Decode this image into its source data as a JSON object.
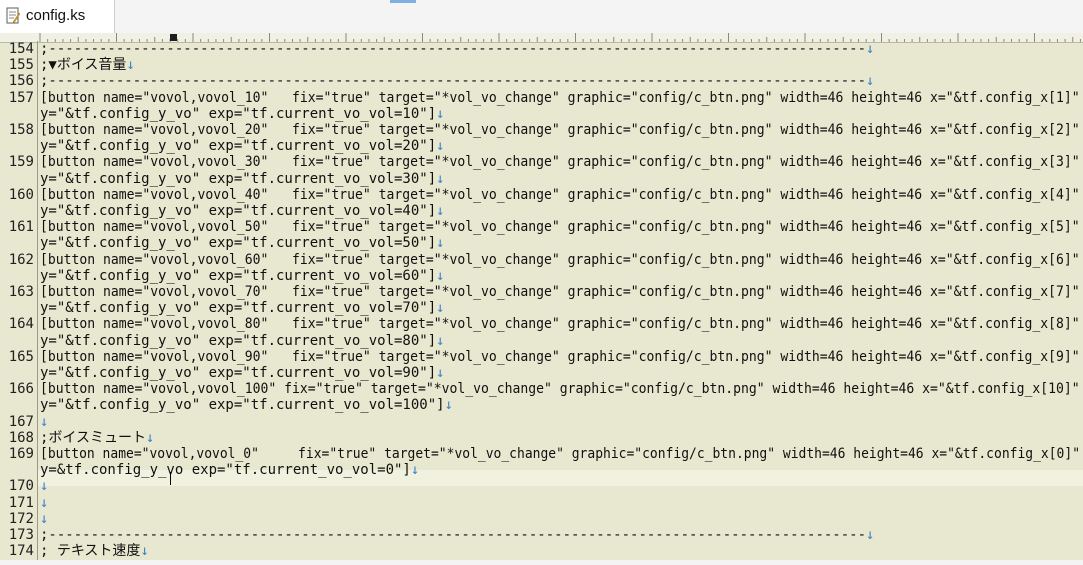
{
  "tab": {
    "title": "config.ks",
    "icon": "document-icon"
  },
  "eol_mark": "↓",
  "lines": [
    {
      "num": "154",
      "text": ";-------------------------------------------------------------------------------------------------"
    },
    {
      "num": "155",
      "text": ";▼ボイス音量"
    },
    {
      "num": "156",
      "text": ";-------------------------------------------------------------------------------------------------"
    },
    {
      "num": "157",
      "text": "[button name=\"vovol,vovol_10\"   fix=\"true\" target=\"*vol_vo_change\" graphic=\"config/c_btn.png\" width=46 height=46 x=\"&tf.config_x[1]\""
    },
    {
      "num": "",
      "text": "y=\"&tf.config_y_vo\" exp=\"tf.current_vo_vol=10\"]"
    },
    {
      "num": "158",
      "text": "[button name=\"vovol,vovol_20\"   fix=\"true\" target=\"*vol_vo_change\" graphic=\"config/c_btn.png\" width=46 height=46 x=\"&tf.config_x[2]\""
    },
    {
      "num": "",
      "text": "y=\"&tf.config_y_vo\" exp=\"tf.current_vo_vol=20\"]"
    },
    {
      "num": "159",
      "text": "[button name=\"vovol,vovol_30\"   fix=\"true\" target=\"*vol_vo_change\" graphic=\"config/c_btn.png\" width=46 height=46 x=\"&tf.config_x[3]\""
    },
    {
      "num": "",
      "text": "y=\"&tf.config_y_vo\" exp=\"tf.current_vo_vol=30\"]"
    },
    {
      "num": "160",
      "text": "[button name=\"vovol,vovol_40\"   fix=\"true\" target=\"*vol_vo_change\" graphic=\"config/c_btn.png\" width=46 height=46 x=\"&tf.config_x[4]\""
    },
    {
      "num": "",
      "text": "y=\"&tf.config_y_vo\" exp=\"tf.current_vo_vol=40\"]"
    },
    {
      "num": "161",
      "text": "[button name=\"vovol,vovol_50\"   fix=\"true\" target=\"*vol_vo_change\" graphic=\"config/c_btn.png\" width=46 height=46 x=\"&tf.config_x[5]\""
    },
    {
      "num": "",
      "text": "y=\"&tf.config_y_vo\" exp=\"tf.current_vo_vol=50\"]"
    },
    {
      "num": "162",
      "text": "[button name=\"vovol,vovol_60\"   fix=\"true\" target=\"*vol_vo_change\" graphic=\"config/c_btn.png\" width=46 height=46 x=\"&tf.config_x[6]\""
    },
    {
      "num": "",
      "text": "y=\"&tf.config_y_vo\" exp=\"tf.current_vo_vol=60\"]"
    },
    {
      "num": "163",
      "text": "[button name=\"vovol,vovol_70\"   fix=\"true\" target=\"*vol_vo_change\" graphic=\"config/c_btn.png\" width=46 height=46 x=\"&tf.config_x[7]\""
    },
    {
      "num": "",
      "text": "y=\"&tf.config_y_vo\" exp=\"tf.current_vo_vol=70\"]"
    },
    {
      "num": "164",
      "text": "[button name=\"vovol,vovol_80\"   fix=\"true\" target=\"*vol_vo_change\" graphic=\"config/c_btn.png\" width=46 height=46 x=\"&tf.config_x[8]\""
    },
    {
      "num": "",
      "text": "y=\"&tf.config_y_vo\" exp=\"tf.current_vo_vol=80\"]"
    },
    {
      "num": "165",
      "text": "[button name=\"vovol,vovol_90\"   fix=\"true\" target=\"*vol_vo_change\" graphic=\"config/c_btn.png\" width=46 height=46 x=\"&tf.config_x[9]\""
    },
    {
      "num": "",
      "text": "y=\"&tf.config_y_vo\" exp=\"tf.current_vo_vol=90\"]"
    },
    {
      "num": "166",
      "text": "[button name=\"vovol,vovol_100\" fix=\"true\" target=\"*vol_vo_change\" graphic=\"config/c_btn.png\" width=46 height=46 x=\"&tf.config_x[10]\""
    },
    {
      "num": "",
      "text": "y=\"&tf.config_y_vo\" exp=\"tf.current_vo_vol=100\"]"
    },
    {
      "num": "167",
      "text": ""
    },
    {
      "num": "168",
      "text": ";ボイスミュート"
    },
    {
      "num": "169",
      "text": "[button name=\"vovol,vovol_0\"     fix=\"true\" target=\"*vol_vo_change\" graphic=\"config/c_btn.png\" width=46 height=46 x=\"&tf.config_x[0]\""
    },
    {
      "num": "",
      "text": "y=&tf.config_y_vo exp=\"tf.current_vo_vol=0\"]"
    },
    {
      "num": "170",
      "text": ""
    },
    {
      "num": "171",
      "text": ""
    },
    {
      "num": "172",
      "text": ""
    },
    {
      "num": "173",
      "text": ";-------------------------------------------------------------------------------------------------"
    },
    {
      "num": "174",
      "text": "; テキスト速度"
    }
  ]
}
